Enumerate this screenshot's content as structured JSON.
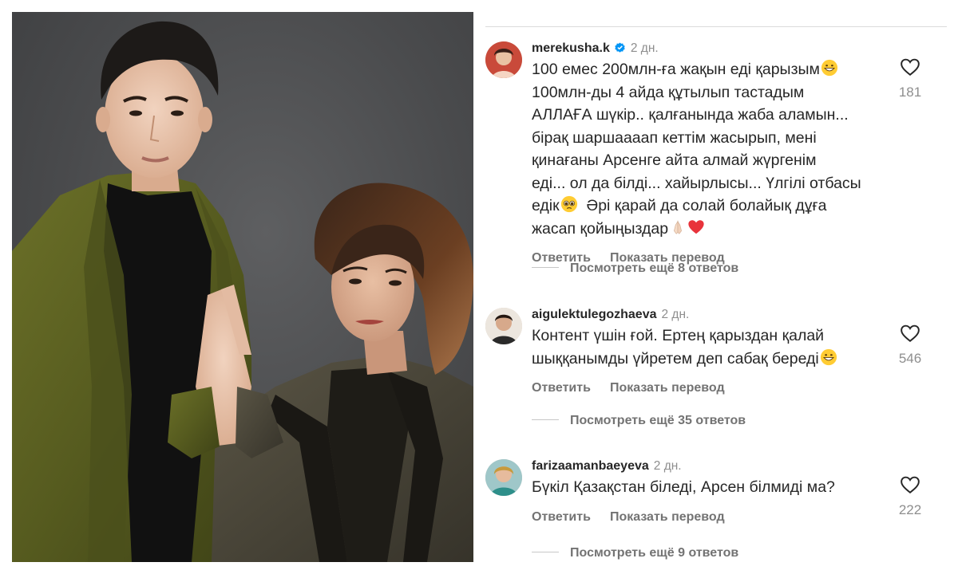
{
  "photo": {
    "alt": ""
  },
  "comments": [
    {
      "username": "merekusha.k",
      "verified": true,
      "time": "2 дн.",
      "text_lines": [
        "100 емес 200млн-ға жақын еді қарызым",
        "100млн-ды 4 айда құтылып тастадым",
        "АЛЛАҒА шүкір.. қалғанында жаба аламын...",
        "бірақ шаршаааап кеттім жасырып, мені",
        "қинағаны Арсенге айта алмай жүргенім",
        "еді... ол да білді... хайырлысы... Үлгілі отбасы",
        "едік",
        "Әрі қарай да солай болайық дұға",
        "жасап қойыңыздар"
      ],
      "likes": "181",
      "reply_label": "Ответить",
      "translate_label": "Показать перевод",
      "more_replies": "Посмотреть ещё 8 ответов"
    },
    {
      "username": "aigulektulegozhaeva",
      "verified": false,
      "time": "2 дн.",
      "text_lines": [
        "Контент үшін ғой. Ертең қарыздан қалай",
        "шыққанымды үйретем деп сабақ береді"
      ],
      "likes": "546",
      "reply_label": "Ответить",
      "translate_label": "Показать перевод",
      "more_replies": "Посмотреть ещё 35 ответов"
    },
    {
      "username": "farizaamanbaeyeva",
      "verified": false,
      "time": "2 дн.",
      "text_lines": [
        "Бүкіл Қазақстан біледі, Арсен білмиді ма?"
      ],
      "likes": "222",
      "reply_label": "Ответить",
      "translate_label": "Показать перевод",
      "more_replies": "Посмотреть ещё 9 ответов"
    }
  ],
  "icons": {
    "like": "heart-outline-icon",
    "verified": "verified-badge-icon",
    "emoji_grin": "grinning-face-emoji",
    "emoji_pleading": "pleading-face-emoji",
    "emoji_hands": "folded-hands-emoji",
    "emoji_heart": "red-heart-emoji"
  },
  "colors": {
    "verified": "#0095f6",
    "muted": "#8e8e8e",
    "text": "#262626",
    "heart": "#e8333b",
    "kimono_green": "#5a5f22",
    "kimono_grey": "#4a4637"
  }
}
